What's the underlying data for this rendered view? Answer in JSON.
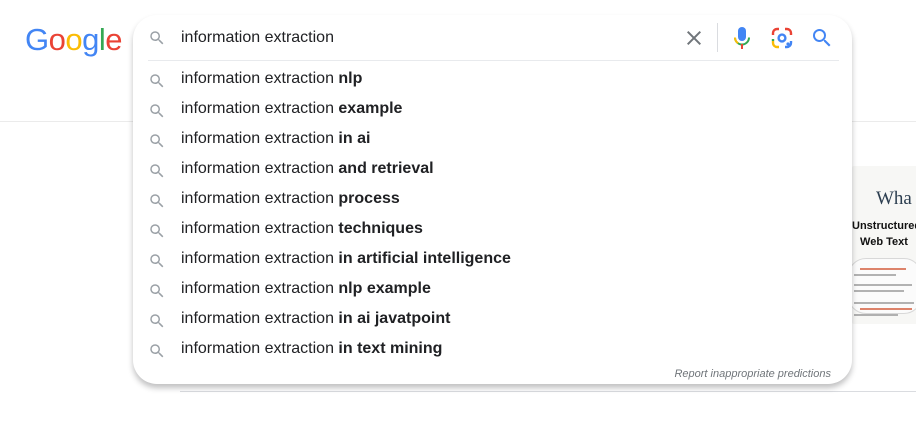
{
  "logo": {
    "letters": [
      "G",
      "o",
      "o",
      "g",
      "l",
      "e"
    ]
  },
  "search": {
    "query": "information extraction",
    "clear_icon": "close-icon",
    "voice_icon": "microphone-icon",
    "lens_icon": "camera-lens-icon",
    "submit_icon": "search-icon"
  },
  "suggestions": [
    {
      "prefix": "information extraction ",
      "bold": "nlp"
    },
    {
      "prefix": "information extraction ",
      "bold": "example"
    },
    {
      "prefix": "information extraction ",
      "bold": "in ai"
    },
    {
      "prefix": "information extraction ",
      "bold": "and retrieval"
    },
    {
      "prefix": "information extraction ",
      "bold": "process"
    },
    {
      "prefix": "information extraction ",
      "bold": "techniques"
    },
    {
      "prefix": "information extraction ",
      "bold": "in artificial intelligence"
    },
    {
      "prefix": "information extraction ",
      "bold": "nlp example"
    },
    {
      "prefix": "information extraction ",
      "bold": "in ai javatpoint"
    },
    {
      "prefix": "information extraction ",
      "bold": "in text mining"
    }
  ],
  "report_link": "Report inappropriate predictions",
  "thumbnail": {
    "title": "Wha",
    "subtitle_line1": "Unstructured",
    "subtitle_line2": "Web Text"
  },
  "colors": {
    "blue": "#4285f4",
    "red": "#ea4335",
    "yellow": "#fbbc05",
    "green": "#34a853",
    "icon_gray": "#9aa0a6",
    "text": "#202124"
  }
}
